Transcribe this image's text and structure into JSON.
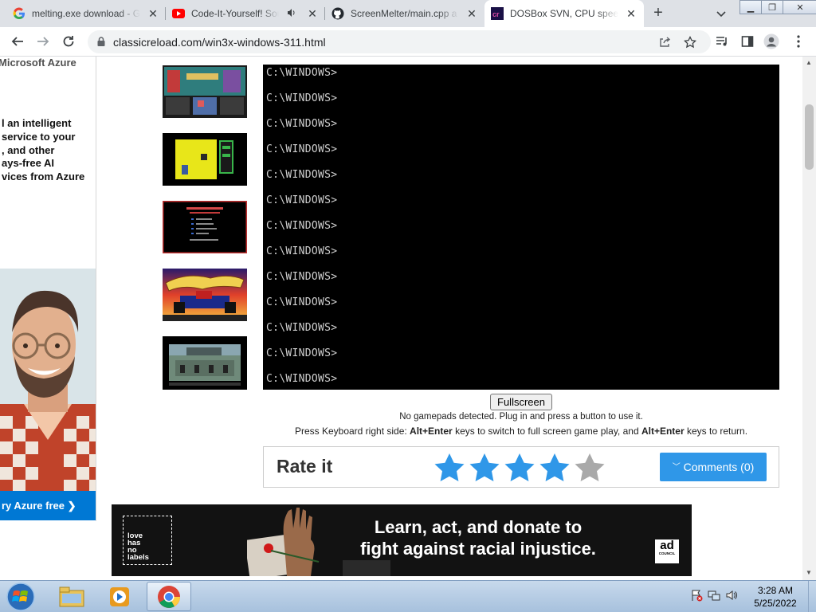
{
  "browser": {
    "tabs": [
      {
        "title": "melting.exe download - G",
        "icon": "google-icon"
      },
      {
        "title": "Code-It-Yourself! Sou",
        "icon": "youtube-icon",
        "audio": true
      },
      {
        "title": "ScreenMelter/main.cpp a",
        "icon": "github-icon"
      },
      {
        "title": "DOSBox SVN, CPU speed",
        "icon": "classicreload-icon",
        "active": true
      }
    ],
    "url": "classicreload.com/win3x-windows-311.html"
  },
  "ad": {
    "brand": "Microsoft Azure",
    "lines": [
      "l an intelligent",
      " service to your",
      ", and other",
      "ays-free AI",
      "vices from Azure"
    ],
    "cta": "ry Azure free ❯"
  },
  "dos": {
    "lines": [
      "C:\\WINDOWS>",
      "C:\\WINDOWS>",
      "C:\\WINDOWS>",
      "C:\\WINDOWS>",
      "C:\\WINDOWS>",
      "C:\\WINDOWS>",
      "C:\\WINDOWS>",
      "C:\\WINDOWS>",
      "C:\\WINDOWS>",
      "C:\\WINDOWS>",
      "C:\\WINDOWS>",
      "C:\\WINDOWS>",
      "C:\\WINDOWS>"
    ]
  },
  "controls": {
    "fullscreen": "Fullscreen",
    "gamepad_note": "No gamepads detected. Plug in and press a button to use it.",
    "kb_prefix": "Press Keyboard right side: ",
    "kb_key1": "Alt+Enter",
    "kb_mid": " keys to switch to full screen game play, and ",
    "kb_key2": "Alt+Enter",
    "kb_suffix": " keys to return."
  },
  "rating": {
    "label": "Rate it",
    "stars_filled": 4,
    "stars_total": 5,
    "comments": "Comments (0)"
  },
  "banner": {
    "logo_text": [
      "love",
      "has",
      "no",
      "labels"
    ],
    "headline_1": "Learn, act, and donate to",
    "headline_2": "fight against racial injustice.",
    "ad_badge": "ad",
    "ad_badge_sub": "COUNCIL"
  },
  "taskbar": {
    "time": "3:28 AM",
    "date": "5/25/2022"
  },
  "colors": {
    "star_filled": "#2f97e8",
    "star_empty": "#a9a9a9",
    "comments_button": "#2f97e8",
    "azure_blue": "#0078d4"
  }
}
